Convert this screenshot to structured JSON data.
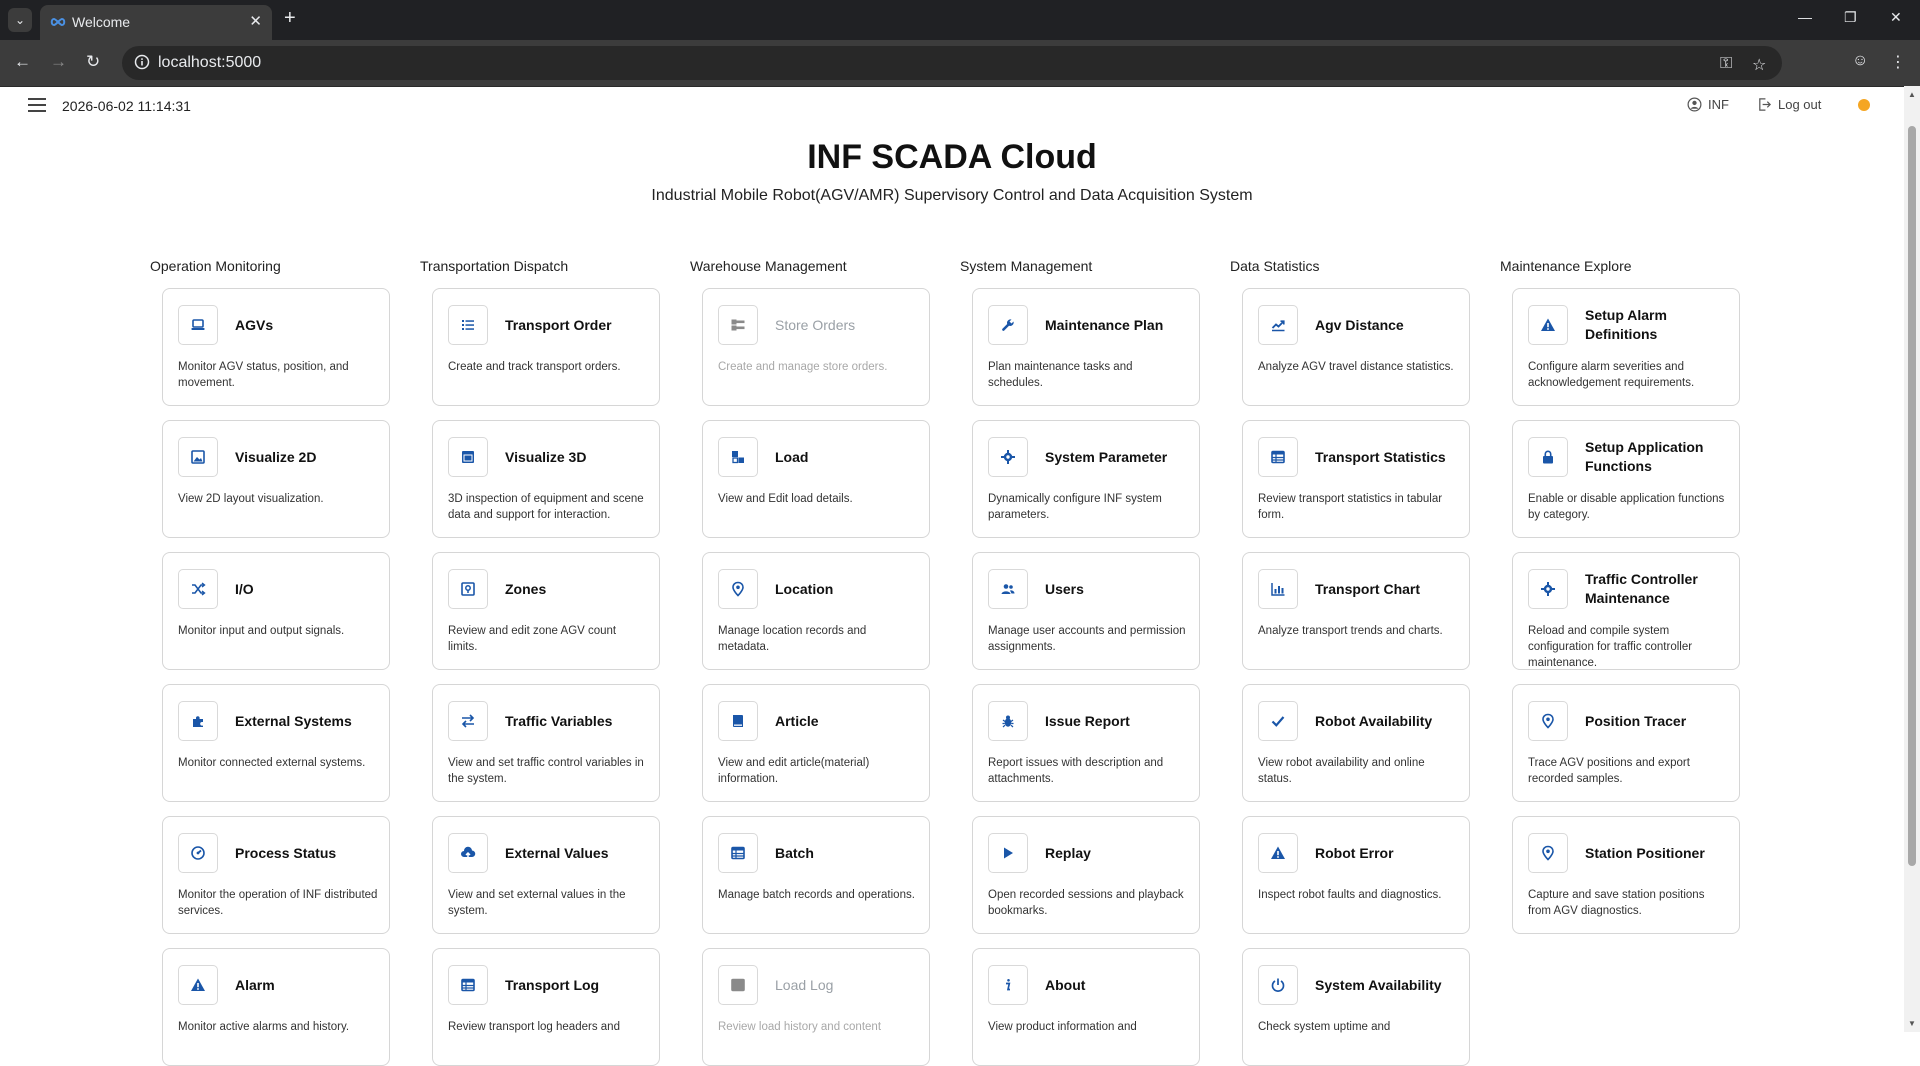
{
  "browser": {
    "tab_title": "Welcome",
    "url": "localhost:5000"
  },
  "header": {
    "datetime": "2026-06-02 11:14:31",
    "user": "INF",
    "logout": "Log out"
  },
  "hero": {
    "title": "INF SCADA Cloud",
    "subtitle": "Industrial Mobile Robot(AGV/AMR) Supervisory Control and Data Acquisition System"
  },
  "colors": {
    "accent": "#1a56a8",
    "disabled": "#9aa0a6",
    "status": "#f5a623"
  },
  "sections": [
    {
      "title": "Operation Monitoring",
      "items": [
        {
          "title": "AGVs",
          "desc": "Monitor AGV status, position, and movement.",
          "icon": "laptop-icon"
        },
        {
          "title": "Visualize 2D",
          "desc": "View 2D layout visualization.",
          "icon": "image-icon"
        },
        {
          "title": "I/O",
          "desc": "Monitor input and output signals.",
          "icon": "shuffle-icon"
        },
        {
          "title": "External Systems",
          "desc": "Monitor connected external systems.",
          "icon": "puzzle-icon"
        },
        {
          "title": "Process Status",
          "desc": "Monitor the operation of INF distributed services.",
          "icon": "gauge-icon"
        },
        {
          "title": "Alarm",
          "desc": "Monitor active alarms and history.",
          "icon": "warning-icon"
        }
      ]
    },
    {
      "title": "Transportation Dispatch",
      "items": [
        {
          "title": "Transport Order",
          "desc": "Create and track transport orders.",
          "icon": "list-icon"
        },
        {
          "title": "Visualize 3D",
          "desc": "3D inspection of equipment and scene data and support for interaction.",
          "icon": "window-icon"
        },
        {
          "title": "Zones",
          "desc": "Review and edit zone AGV count limits.",
          "icon": "zone-icon"
        },
        {
          "title": "Traffic Variables",
          "desc": "View and set traffic control variables in the system.",
          "icon": "swap-icon"
        },
        {
          "title": "External Values",
          "desc": "View and set external values in the system.",
          "icon": "cloud-upload-icon"
        },
        {
          "title": "Transport Log",
          "desc": "Review transport log headers and",
          "icon": "table-icon"
        }
      ]
    },
    {
      "title": "Warehouse Management",
      "items": [
        {
          "title": "Store Orders",
          "desc": "Create and manage store orders.",
          "icon": "store-list-icon",
          "disabled": true
        },
        {
          "title": "Load",
          "desc": "View and Edit load details.",
          "icon": "boxes-icon"
        },
        {
          "title": "Location",
          "desc": "Manage location records and metadata.",
          "icon": "map-pin-icon"
        },
        {
          "title": "Article",
          "desc": "View and edit article(material) information.",
          "icon": "book-icon"
        },
        {
          "title": "Batch",
          "desc": "Manage batch records and operations.",
          "icon": "table-icon"
        },
        {
          "title": "Load Log",
          "desc": "Review load history and content",
          "icon": "table-icon",
          "disabled": true
        }
      ]
    },
    {
      "title": "System Management",
      "items": [
        {
          "title": "Maintenance Plan",
          "desc": "Plan maintenance tasks and schedules.",
          "icon": "wrench-icon"
        },
        {
          "title": "System Parameter",
          "desc": "Dynamically configure INF system parameters.",
          "icon": "gear-icon"
        },
        {
          "title": "Users",
          "desc": "Manage user accounts and permission assignments.",
          "icon": "users-icon"
        },
        {
          "title": "Issue Report",
          "desc": "Report issues with description and attachments.",
          "icon": "bug-icon"
        },
        {
          "title": "Replay",
          "desc": "Open recorded sessions and playback bookmarks.",
          "icon": "play-icon"
        },
        {
          "title": "About",
          "desc": "View product information and",
          "icon": "info-icon"
        }
      ]
    },
    {
      "title": "Data Statistics",
      "items": [
        {
          "title": "Agv Distance",
          "desc": "Analyze AGV travel distance statistics.",
          "icon": "trend-icon"
        },
        {
          "title": "Transport Statistics",
          "desc": "Review transport statistics in tabular form.",
          "icon": "table-icon"
        },
        {
          "title": "Transport Chart",
          "desc": "Analyze transport trends and charts.",
          "icon": "bar-chart-icon"
        },
        {
          "title": "Robot Availability",
          "desc": "View robot availability and online status.",
          "icon": "check-icon"
        },
        {
          "title": "Robot Error",
          "desc": "Inspect robot faults and diagnostics.",
          "icon": "warning-icon"
        },
        {
          "title": "System Availability",
          "desc": "Check system uptime and",
          "icon": "power-icon"
        }
      ]
    },
    {
      "title": "Maintenance Explore",
      "items": [
        {
          "title": "Setup Alarm Definitions",
          "desc": "Configure alarm severities and acknowledgement requirements.",
          "icon": "warning-icon"
        },
        {
          "title": "Setup Application Functions",
          "desc": "Enable or disable application functions by category.",
          "icon": "lock-icon"
        },
        {
          "title": "Traffic Controller Maintenance",
          "desc": "Reload and compile system configuration for traffic controller maintenance.",
          "icon": "gear-icon"
        },
        {
          "title": "Position Tracer",
          "desc": "Trace AGV positions and export recorded samples.",
          "icon": "map-pin-icon"
        },
        {
          "title": "Station Positioner",
          "desc": "Capture and save station positions from AGV diagnostics.",
          "icon": "map-pin-icon"
        }
      ]
    }
  ]
}
